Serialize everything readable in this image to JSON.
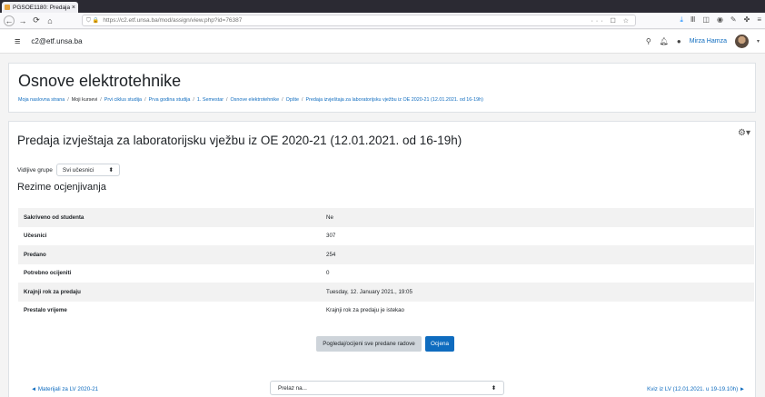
{
  "browser": {
    "tab_title": "PGSOE1180: Predaja izv",
    "tab_close": "×",
    "url": "https://c2.etf.unsa.ba/mod/assign/view.php?id=76387",
    "url_actions": "··· ☐ ☆"
  },
  "header": {
    "site_name": "c2@etf.unsa.ba",
    "user_name": "Mirza Hamza"
  },
  "course": {
    "title": "Osnove elektrotehnike",
    "breadcrumb": [
      "Moja naslovna strana",
      "Moji kursevi",
      "Prvi ciklus studija",
      "Prva godina studija",
      "1. Semestar",
      "Osnove elektrotehnike",
      "Opšte",
      "Predaja izvještaja za laboratorijsku vježbu iz OE 2020-21 (12.01.2021. od 16-19h)"
    ],
    "breadcrumb_sep": "/"
  },
  "assignment": {
    "title": "Predaja izvještaja za laboratorijsku vježbu iz OE 2020-21 (12.01.2021. od 16-19h)",
    "group_label": "Vidljive grupe",
    "group_value": "Svi učesnici",
    "summary_heading": "Rezime ocjenjivanja",
    "rows": [
      {
        "label": "Sakriveno od studenta",
        "value": "Ne"
      },
      {
        "label": "Učesnici",
        "value": "307"
      },
      {
        "label": "Predano",
        "value": "254"
      },
      {
        "label": "Potrebno ocijeniti",
        "value": "0"
      },
      {
        "label": "Krajnji rok za predaju",
        "value": "Tuesday, 12. January 2021., 19:05"
      },
      {
        "label": "Prestalo vrijeme",
        "value": "Krajnji rok za predaju je istekao"
      }
    ],
    "view_all_button": "Pogledaj/ocijeni sve predane radove",
    "grade_button": "Ocjena"
  },
  "footer": {
    "prev_link": "◄ Materijali za LV 2020-21",
    "jump_placeholder": "Prelaz na...",
    "next_link": "Kviz iz LV (12.01.2021. u 19-19.10h) ►"
  }
}
